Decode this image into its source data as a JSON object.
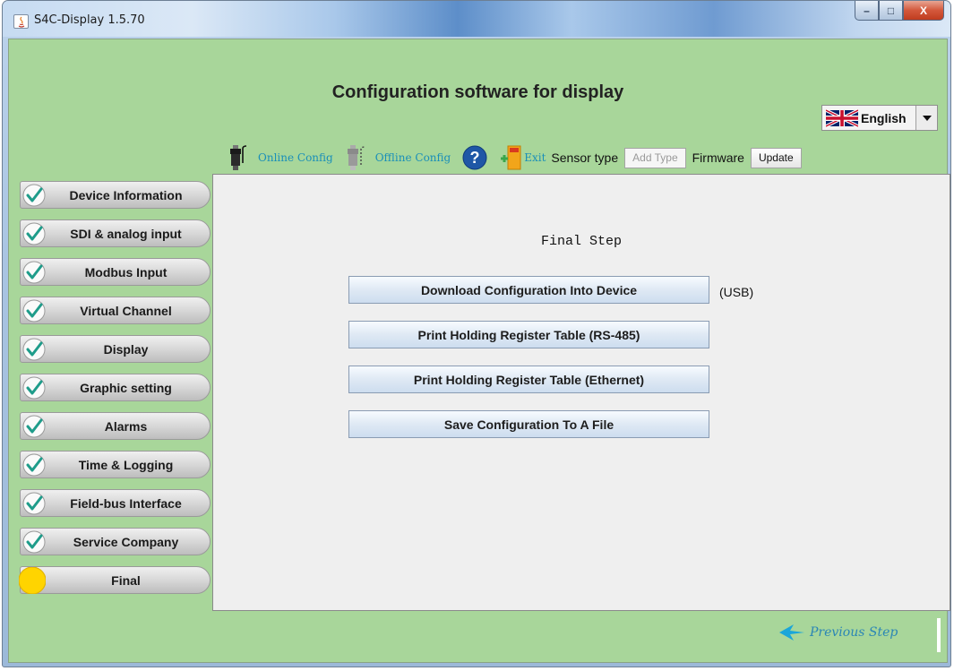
{
  "window": {
    "title": "S4C-Display 1.5.70",
    "controls": {
      "minimize": "–",
      "maximize": "□",
      "close": "X"
    }
  },
  "header": {
    "app_title": "Configuration software for display",
    "language": {
      "selected": "English",
      "icon": "uk-flag-icon"
    }
  },
  "toolbar": {
    "online_config": "Online Config",
    "offline_config": "Offline Config",
    "help_icon": "question-mark-icon",
    "exit": "Exit",
    "sensor_type_label": "Sensor type",
    "add_type_button": "Add Type",
    "firmware_label": "Firmware",
    "update_button": "Update"
  },
  "sidebar": {
    "items": [
      {
        "label": "Device Information",
        "status": "done"
      },
      {
        "label": "SDI & analog input",
        "status": "done"
      },
      {
        "label": "Modbus Input",
        "status": "done"
      },
      {
        "label": "Virtual Channel",
        "status": "done"
      },
      {
        "label": "Display",
        "status": "done"
      },
      {
        "label": "Graphic setting",
        "status": "done"
      },
      {
        "label": "Alarms",
        "status": "done"
      },
      {
        "label": "Time & Logging",
        "status": "done"
      },
      {
        "label": "Field-bus Interface",
        "status": "done"
      },
      {
        "label": "Service Company",
        "status": "done"
      },
      {
        "label": "Final",
        "status": "current"
      }
    ]
  },
  "main": {
    "step_title": "Final Step",
    "buttons": {
      "download": "Download Configuration Into Device",
      "print_rs485": "Print Holding Register Table (RS-485)",
      "print_ethernet": "Print Holding Register Table (Ethernet)",
      "save": "Save Configuration To A File"
    },
    "usb_note": "(USB)"
  },
  "footer": {
    "previous_step": "Previous Step"
  },
  "colors": {
    "client_bg": "#a8d69a",
    "link": "#1a8fb8",
    "check": "#1e9c8a",
    "current_step": "#ffd400"
  }
}
